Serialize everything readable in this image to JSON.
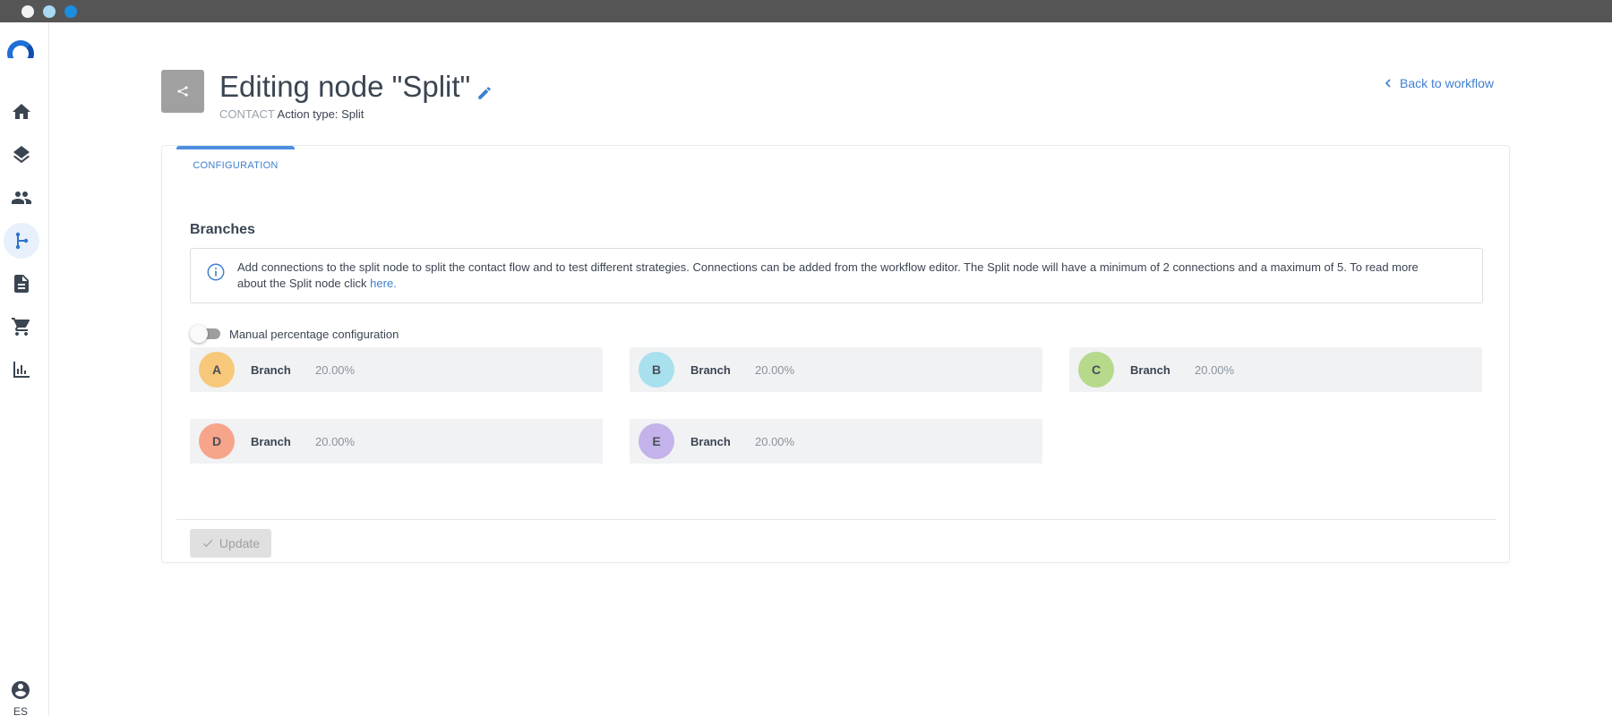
{
  "window": {
    "controls": [
      "close",
      "minimize",
      "maximize"
    ]
  },
  "sidebar": {
    "logo": "app-logo",
    "items": [
      {
        "name": "home",
        "icon": "home-icon",
        "active": false
      },
      {
        "name": "layers",
        "icon": "layers-icon",
        "active": false
      },
      {
        "name": "contacts",
        "icon": "people-icon",
        "active": false
      },
      {
        "name": "workflows",
        "icon": "workflow-icon",
        "active": true
      },
      {
        "name": "documents",
        "icon": "document-icon",
        "active": false
      },
      {
        "name": "shop",
        "icon": "cart-icon",
        "active": false
      },
      {
        "name": "analytics",
        "icon": "bar-chart-icon",
        "active": false
      }
    ],
    "user_icon": "account-circle-icon",
    "language": "ES"
  },
  "header": {
    "title": "Editing node \"Split\"",
    "kind": "CONTACT",
    "action_type": "Action type: Split",
    "back_label": "Back to workflow"
  },
  "tabs": [
    {
      "label": "CONFIGURATION",
      "active": true
    }
  ],
  "branches_section": {
    "title": "Branches",
    "info_text": "Add connections to the split node to split the contact flow and to test different strategies. Connections can be added from the workflow editor. The Split node will have a minimum of 2 connections and a maximum of 5. To read more about the Split node click ",
    "info_link": "here.",
    "toggle_label": "Manual percentage configuration",
    "toggle_on": false,
    "branches": [
      {
        "letter": "A",
        "label": "Branch",
        "percent": "20.00%",
        "color": "#f8c87a"
      },
      {
        "letter": "B",
        "label": "Branch",
        "percent": "20.00%",
        "color": "#a8e0ee"
      },
      {
        "letter": "C",
        "label": "Branch",
        "percent": "20.00%",
        "color": "#b6d98c"
      },
      {
        "letter": "D",
        "label": "Branch",
        "percent": "20.00%",
        "color": "#f6a58b"
      },
      {
        "letter": "E",
        "label": "Branch",
        "percent": "20.00%",
        "color": "#c3b3ea"
      }
    ]
  },
  "actions": {
    "update_label": "Update",
    "update_enabled": false
  },
  "colors": {
    "accent": "#3d7fd0",
    "node_icon_bg": "#a0a0a0",
    "titlebar": "#555555"
  }
}
